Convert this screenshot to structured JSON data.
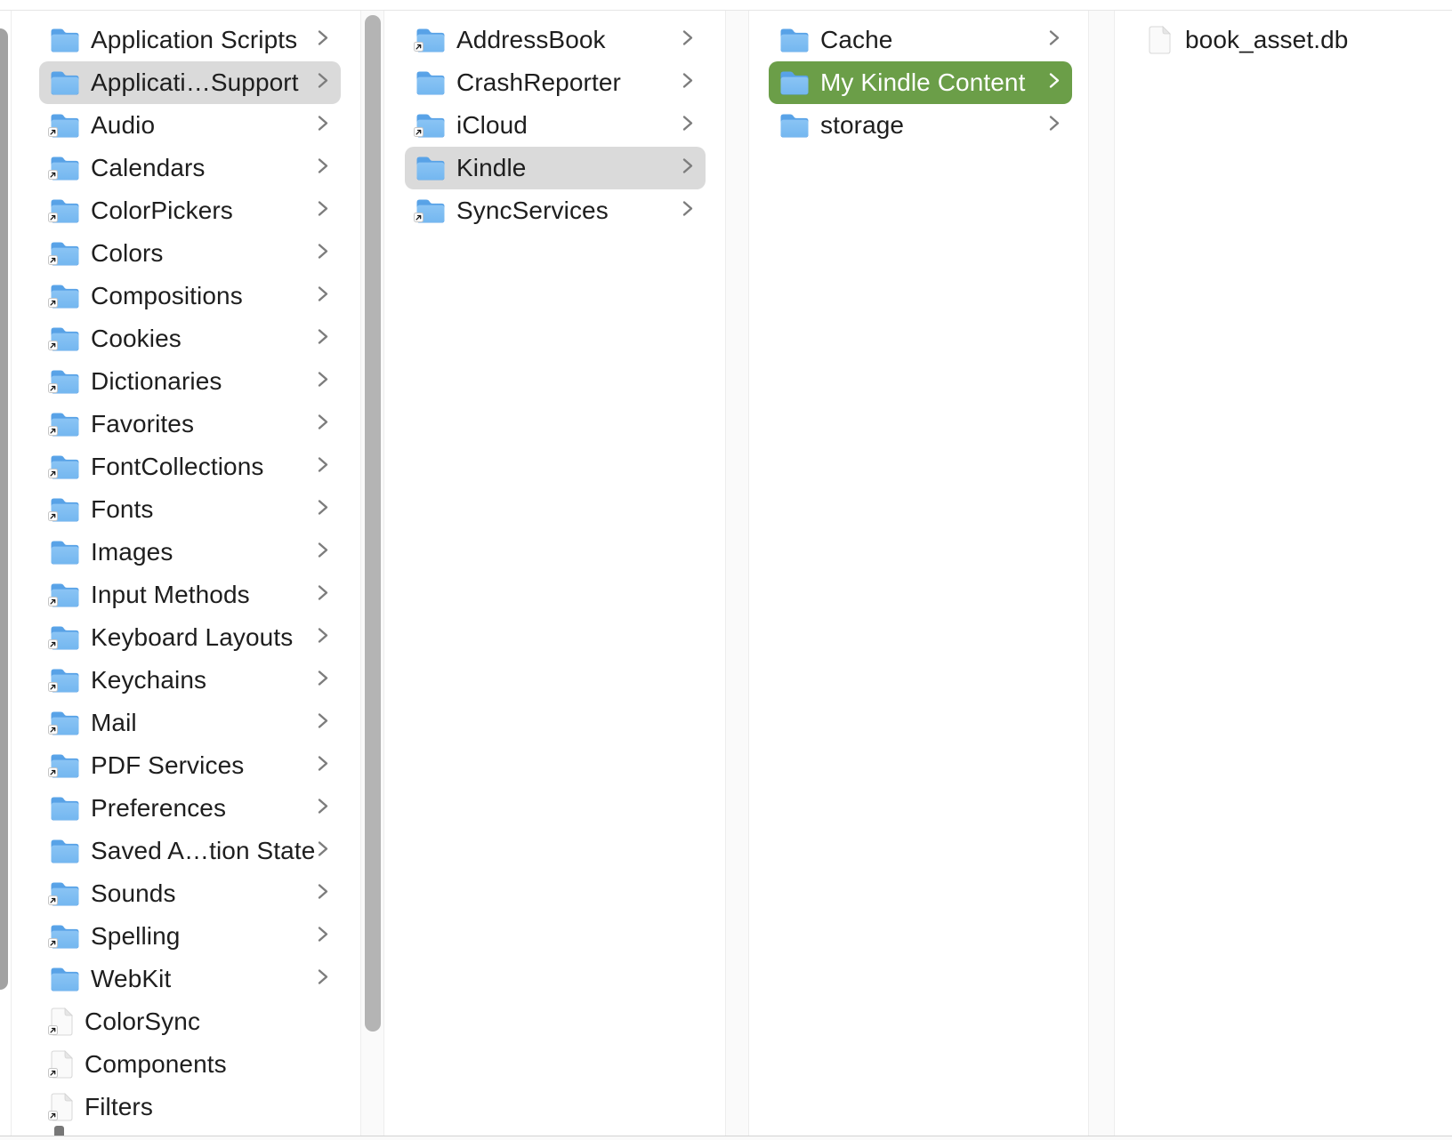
{
  "view": {
    "kind": "finder-column-browser"
  },
  "colors": {
    "selection_green": "#6b9e48",
    "selection_gray": "#dadada",
    "text": "#1e1e1e",
    "selected_text": "#ffffff",
    "folder_blue_front": "#7ec0f3",
    "folder_blue_back": "#539ee4"
  },
  "columns": [
    {
      "id": "column-1",
      "items": [
        {
          "label": "Application Scripts",
          "type": "folder",
          "alias_badge": false,
          "chevron": true,
          "selected": null
        },
        {
          "label": "Applicati…Support",
          "type": "folder",
          "alias_badge": false,
          "chevron": true,
          "selected": "gray"
        },
        {
          "label": "Audio",
          "type": "folder",
          "alias_badge": true,
          "chevron": true,
          "selected": null
        },
        {
          "label": "Calendars",
          "type": "folder",
          "alias_badge": true,
          "chevron": true,
          "selected": null
        },
        {
          "label": "ColorPickers",
          "type": "folder",
          "alias_badge": true,
          "chevron": true,
          "selected": null
        },
        {
          "label": "Colors",
          "type": "folder",
          "alias_badge": true,
          "chevron": true,
          "selected": null
        },
        {
          "label": "Compositions",
          "type": "folder",
          "alias_badge": true,
          "chevron": true,
          "selected": null
        },
        {
          "label": "Cookies",
          "type": "folder",
          "alias_badge": true,
          "chevron": true,
          "selected": null
        },
        {
          "label": "Dictionaries",
          "type": "folder",
          "alias_badge": true,
          "chevron": true,
          "selected": null
        },
        {
          "label": "Favorites",
          "type": "folder",
          "alias_badge": true,
          "chevron": true,
          "selected": null
        },
        {
          "label": "FontCollections",
          "type": "folder",
          "alias_badge": true,
          "chevron": true,
          "selected": null
        },
        {
          "label": "Fonts",
          "type": "folder",
          "alias_badge": true,
          "chevron": true,
          "selected": null
        },
        {
          "label": "Images",
          "type": "folder",
          "alias_badge": false,
          "chevron": true,
          "selected": null
        },
        {
          "label": "Input Methods",
          "type": "folder",
          "alias_badge": true,
          "chevron": true,
          "selected": null
        },
        {
          "label": "Keyboard Layouts",
          "type": "folder",
          "alias_badge": true,
          "chevron": true,
          "selected": null
        },
        {
          "label": "Keychains",
          "type": "folder",
          "alias_badge": true,
          "chevron": true,
          "selected": null
        },
        {
          "label": "Mail",
          "type": "folder",
          "alias_badge": true,
          "chevron": true,
          "selected": null
        },
        {
          "label": "PDF Services",
          "type": "folder",
          "alias_badge": true,
          "chevron": true,
          "selected": null
        },
        {
          "label": "Preferences",
          "type": "folder",
          "alias_badge": false,
          "chevron": true,
          "selected": null
        },
        {
          "label": "Saved A…tion State",
          "type": "folder",
          "alias_badge": false,
          "chevron": true,
          "selected": null
        },
        {
          "label": "Sounds",
          "type": "folder",
          "alias_badge": true,
          "chevron": true,
          "selected": null
        },
        {
          "label": "Spelling",
          "type": "folder",
          "alias_badge": true,
          "chevron": true,
          "selected": null
        },
        {
          "label": "WebKit",
          "type": "folder",
          "alias_badge": false,
          "chevron": true,
          "selected": null
        },
        {
          "label": "ColorSync",
          "type": "file",
          "alias_badge": true,
          "chevron": false,
          "selected": null
        },
        {
          "label": "Components",
          "type": "file",
          "alias_badge": true,
          "chevron": false,
          "selected": null
        },
        {
          "label": "Filters",
          "type": "file",
          "alias_badge": true,
          "chevron": false,
          "selected": null
        }
      ]
    },
    {
      "id": "column-2",
      "items": [
        {
          "label": "AddressBook",
          "type": "folder",
          "alias_badge": true,
          "chevron": true,
          "selected": null
        },
        {
          "label": "CrashReporter",
          "type": "folder",
          "alias_badge": false,
          "chevron": true,
          "selected": null
        },
        {
          "label": "iCloud",
          "type": "folder",
          "alias_badge": true,
          "chevron": true,
          "selected": null
        },
        {
          "label": "Kindle",
          "type": "folder",
          "alias_badge": false,
          "chevron": true,
          "selected": "gray"
        },
        {
          "label": "SyncServices",
          "type": "folder",
          "alias_badge": true,
          "chevron": true,
          "selected": null
        }
      ]
    },
    {
      "id": "column-3",
      "items": [
        {
          "label": "Cache",
          "type": "folder",
          "alias_badge": false,
          "chevron": true,
          "selected": null
        },
        {
          "label": "My Kindle Content",
          "type": "folder",
          "alias_badge": false,
          "chevron": true,
          "selected": "green"
        },
        {
          "label": "storage",
          "type": "folder",
          "alias_badge": false,
          "chevron": true,
          "selected": null
        }
      ]
    },
    {
      "id": "column-4",
      "items": [
        {
          "label": "book_asset.db",
          "type": "file",
          "alias_badge": false,
          "chevron": false,
          "selected": null
        }
      ]
    }
  ]
}
